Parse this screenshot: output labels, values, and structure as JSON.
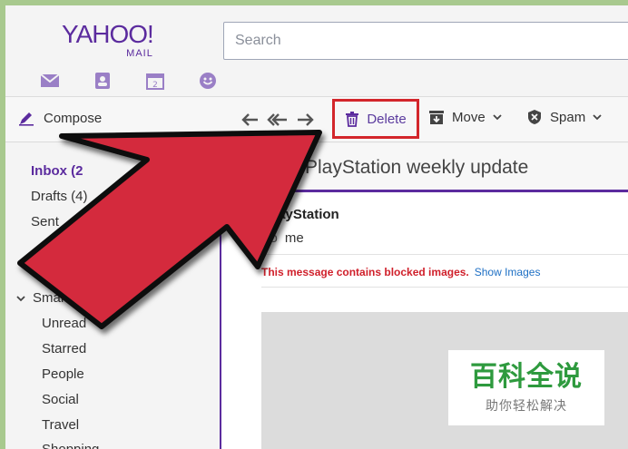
{
  "brand": {
    "logo_main": "YAHOO!",
    "logo_sub": "MAIL",
    "color": "#5b2b9e"
  },
  "header": {
    "search_placeholder": "Search",
    "app_icons": [
      "mail-icon",
      "contacts-icon",
      "calendar-icon",
      "messenger-icon"
    ],
    "calendar_day": "2"
  },
  "toolbar": {
    "compose_label": "Compose",
    "delete_label": "Delete",
    "move_label": "Move",
    "spam_label": "Spam",
    "highlight_color": "#d3262b"
  },
  "sidebar": {
    "folders": [
      {
        "label": "Inbox (2",
        "active": true
      },
      {
        "label": "Drafts (4)",
        "active": false
      },
      {
        "label": "Sent",
        "active": false
      }
    ],
    "smart_views_label": "Smart Views",
    "smart_views": [
      "Unread",
      "Starred",
      "People",
      "Social",
      "Travel",
      "Shopping"
    ]
  },
  "message": {
    "subject": "PlayStation weekly update",
    "sender": "PlayStation",
    "to_label": "To",
    "recipient": "me",
    "blocked_notice": "This message contains blocked images.",
    "show_images_label": "Show Images"
  },
  "overlay": {
    "arrow_color": "#d42a3c"
  },
  "watermark": {
    "title": "百科全说",
    "subtitle": "助你轻松解决",
    "color": "#2e9a3e"
  }
}
